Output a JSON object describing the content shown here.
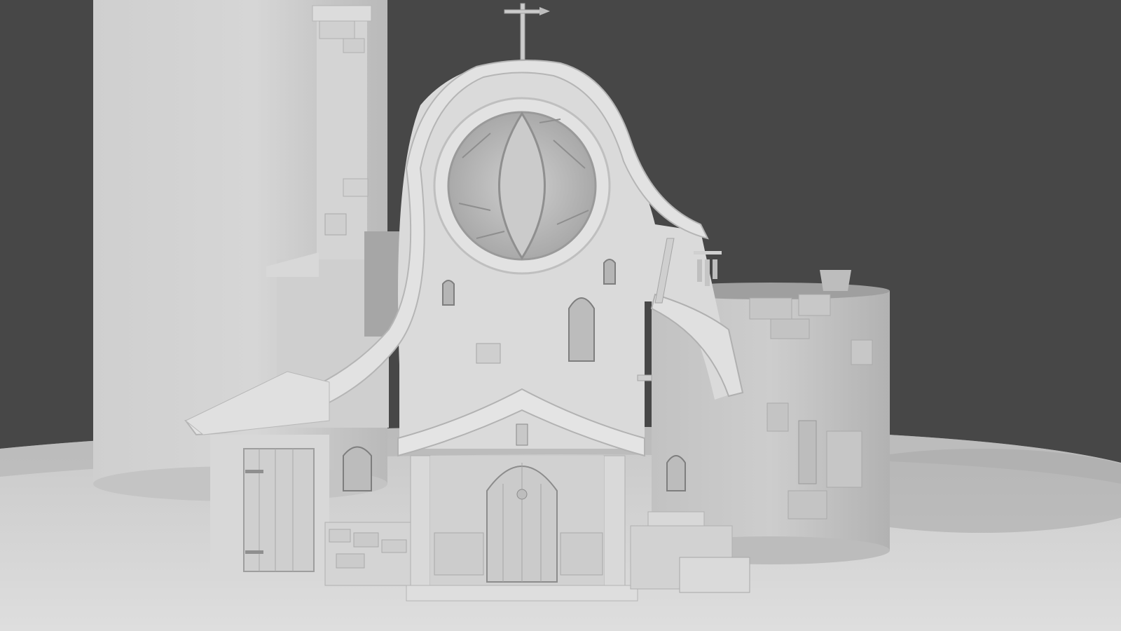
{
  "scene": {
    "kind": "clay-render",
    "subject": "church",
    "colors": {
      "background": "#474747",
      "ground": "#d6d6d6",
      "tower": "#d2d2d2",
      "wall": "#dcdcdc",
      "shadow": "#8a8a8a",
      "dark": "#5a5a5a"
    }
  }
}
